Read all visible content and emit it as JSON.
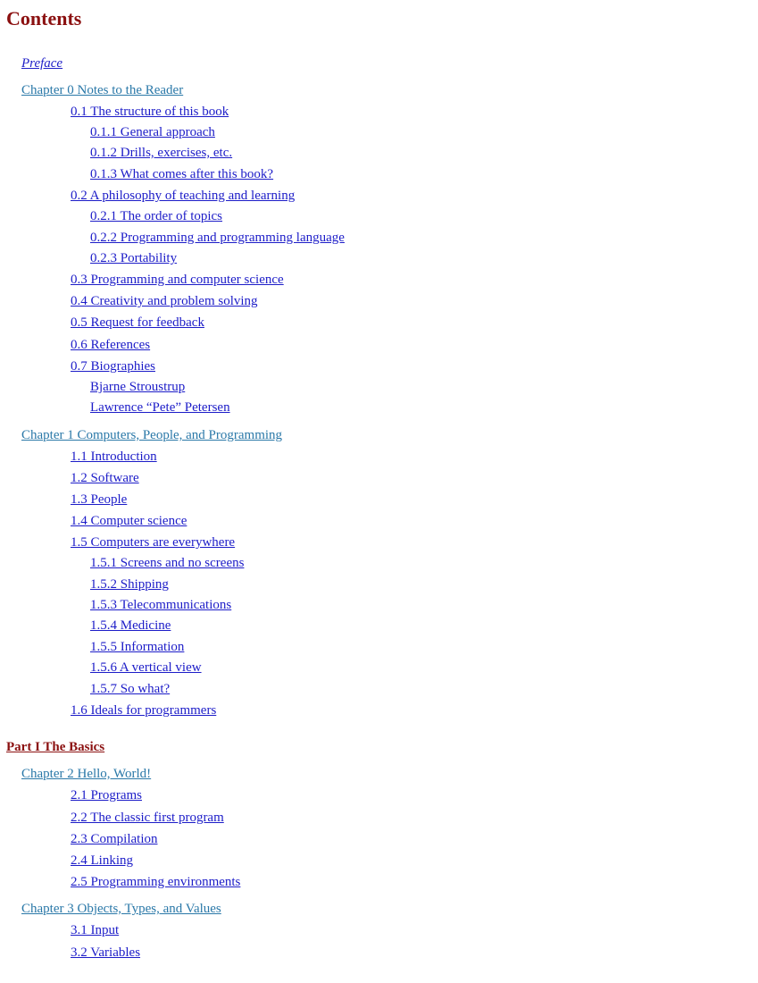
{
  "title": "Contents",
  "colors": {
    "title": "#8b1010",
    "part": "#8b1010",
    "chapter": "#2a78a8",
    "section": "#1c1cc8"
  },
  "toc": [
    {
      "level": "preface",
      "label": "Preface"
    },
    {
      "level": "chapter",
      "label": "Chapter 0 Notes to the Reader"
    },
    {
      "level": "sec",
      "label": "0.1 The structure of this book"
    },
    {
      "level": "subsec",
      "label": "0.1.1 General approach"
    },
    {
      "level": "subsec",
      "label": "0.1.2 Drills, exercises, etc."
    },
    {
      "level": "subsec",
      "label": "0.1.3 What comes after this book?"
    },
    {
      "level": "sec",
      "label": "0.2 A philosophy of teaching and learning"
    },
    {
      "level": "subsec",
      "label": "0.2.1 The order of topics"
    },
    {
      "level": "subsec",
      "label": "0.2.2 Programming and programming language"
    },
    {
      "level": "subsec",
      "label": "0.2.3 Portability"
    },
    {
      "level": "sec",
      "label": "0.3 Programming and computer science"
    },
    {
      "level": "sec",
      "label": "0.4 Creativity and problem solving"
    },
    {
      "level": "sec",
      "label": "0.5 Request for feedback"
    },
    {
      "level": "sec",
      "label": "0.6 References"
    },
    {
      "level": "sec",
      "label": "0.7 Biographies"
    },
    {
      "level": "subsec",
      "label": "Bjarne Stroustrup"
    },
    {
      "level": "subsec",
      "label": "Lawrence “Pete” Petersen"
    },
    {
      "level": "chapter",
      "label": "Chapter 1 Computers, People, and Programming"
    },
    {
      "level": "sec",
      "label": "1.1 Introduction"
    },
    {
      "level": "sec",
      "label": "1.2 Software"
    },
    {
      "level": "sec",
      "label": "1.3 People"
    },
    {
      "level": "sec",
      "label": "1.4 Computer science"
    },
    {
      "level": "sec",
      "label": "1.5 Computers are everywhere"
    },
    {
      "level": "subsec",
      "label": "1.5.1 Screens and no screens"
    },
    {
      "level": "subsec",
      "label": "1.5.2 Shipping"
    },
    {
      "level": "subsec",
      "label": "1.5.3 Telecommunications"
    },
    {
      "level": "subsec",
      "label": "1.5.4 Medicine"
    },
    {
      "level": "subsec",
      "label": "1.5.5 Information"
    },
    {
      "level": "subsec",
      "label": "1.5.6 A vertical view"
    },
    {
      "level": "subsec",
      "label": "1.5.7 So what?"
    },
    {
      "level": "sec",
      "label": "1.6 Ideals for programmers"
    },
    {
      "level": "part",
      "label": "Part I The Basics"
    },
    {
      "level": "chapter",
      "label": "Chapter 2 Hello, World!"
    },
    {
      "level": "sec",
      "label": "2.1 Programs"
    },
    {
      "level": "sec",
      "label": "2.2 The classic first program"
    },
    {
      "level": "sec",
      "label": "2.3 Compilation"
    },
    {
      "level": "sec",
      "label": "2.4 Linking"
    },
    {
      "level": "sec",
      "label": "2.5 Programming environments"
    },
    {
      "level": "chapter",
      "label": "Chapter 3 Objects, Types, and Values"
    },
    {
      "level": "sec",
      "label": "3.1 Input"
    },
    {
      "level": "sec",
      "label": "3.2 Variables"
    }
  ]
}
